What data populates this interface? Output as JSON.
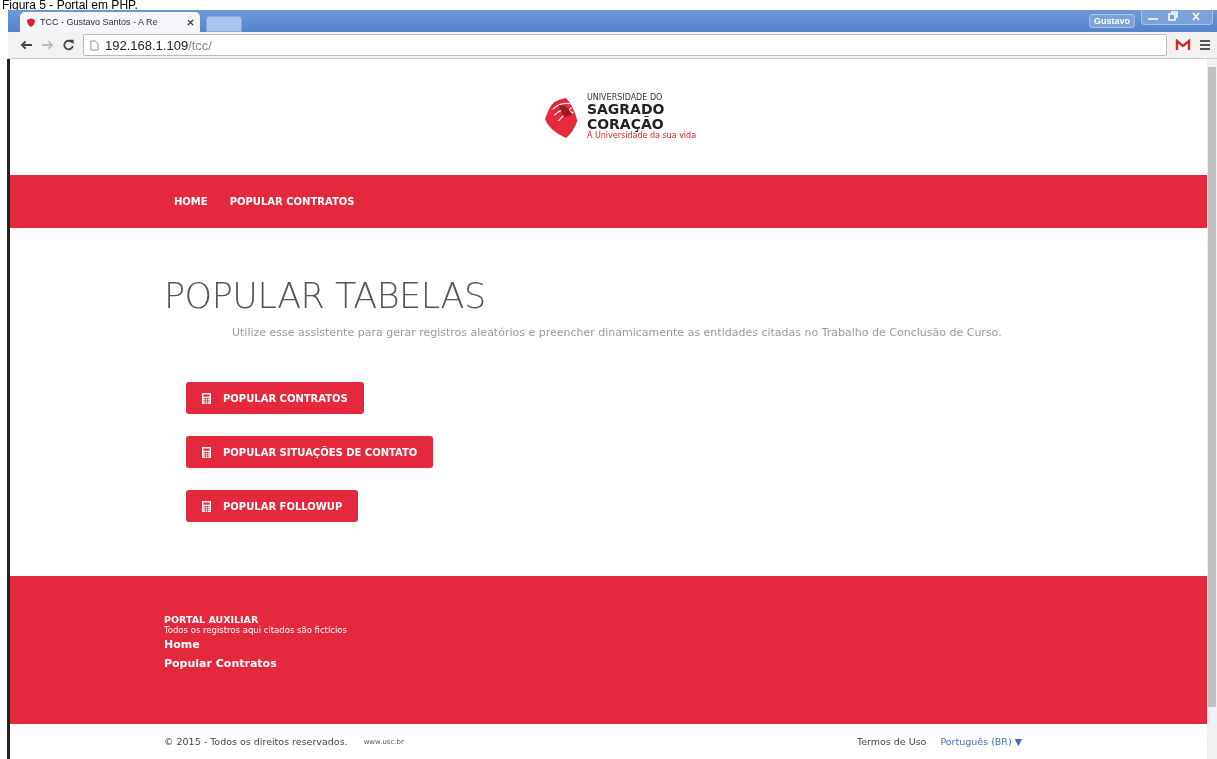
{
  "caption": "Figura 5 - Portal em PHP.",
  "browser": {
    "tab_title": "TCC - Gustavo Santos - A Re",
    "user": "Gustavo",
    "address_host": "192.168.1.109",
    "address_path": "/tcc/"
  },
  "logo": {
    "line1": "UNIVERSIDADE DO",
    "line2": "SAGRADO",
    "line3": "CORAÇÃO",
    "tagline": "A Universidade da sua vida"
  },
  "nav": [
    "HOME",
    "POPULAR CONTRATOS"
  ],
  "heading": "POPULAR TABELAS",
  "intro": "Utilize esse assistente para gerar registros aleatórios e preencher dinamicamente as entidades citadas no Trabalho de Conclusão de Curso.",
  "buttons": [
    "POPULAR CONTRATOS",
    "POPULAR SITUAÇÕES DE CONTATO",
    "POPULAR FOLLOWUP"
  ],
  "footer": {
    "title": "PORTAL AUXILIAR",
    "subtitle": "Todos os registros aqui citados são fictícios",
    "links": [
      "Home",
      "Popular Contratos"
    ]
  },
  "bottom": {
    "copyright": "© 2015 - Todos os direitos reservados.",
    "site": "www.usc.br",
    "terms": "Termos de Uso",
    "language": "Português (BR) ▼"
  }
}
